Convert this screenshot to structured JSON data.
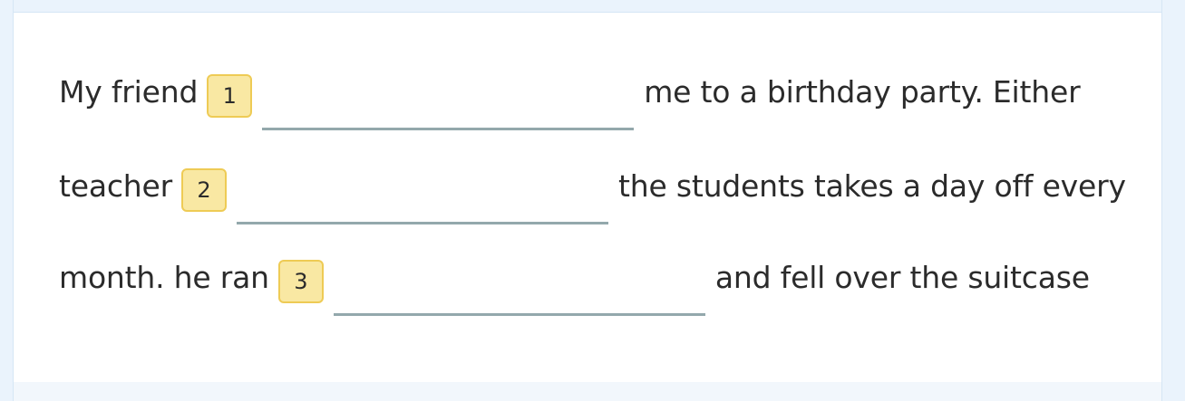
{
  "exercise": {
    "lines": [
      {
        "before": "My friend",
        "badge": "1",
        "blank_value": "",
        "after": "me to a birthday party. Either"
      },
      {
        "before": "teacher",
        "badge": "2",
        "blank_value": "",
        "after": "the students takes a day off every"
      },
      {
        "before": "month. he ran",
        "badge": "3",
        "blank_value": "",
        "after": "and fell over the suitcase"
      }
    ]
  },
  "colors": {
    "background": "#eaf3fc",
    "card": "#ffffff",
    "badge_fill": "#f9e8a3",
    "badge_border": "#eecb55",
    "blank_underline": "#93a8ac",
    "text": "#2b2b2b"
  }
}
